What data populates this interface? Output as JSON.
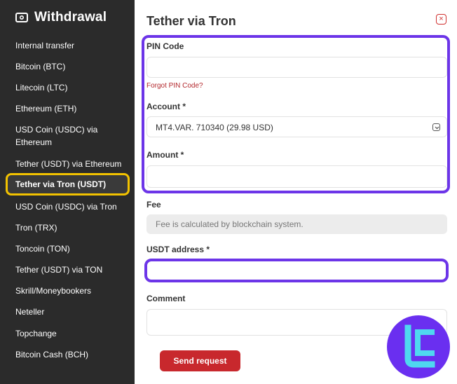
{
  "sidebar": {
    "title": "Withdrawal",
    "items": [
      {
        "label": "Internal transfer"
      },
      {
        "label": "Bitcoin (BTC)"
      },
      {
        "label": "Litecoin (LTC)"
      },
      {
        "label": "Ethereum (ETH)"
      },
      {
        "label": "USD Coin (USDC) via Ethereum"
      },
      {
        "label": "Tether (USDT) via Ethereum"
      },
      {
        "label": "Tether via Tron (USDT)"
      },
      {
        "label": "USD Coin (USDC) via Tron"
      },
      {
        "label": "Tron (TRX)"
      },
      {
        "label": "Toncoin (TON)"
      },
      {
        "label": "Tether (USDT) via TON"
      },
      {
        "label": "Skrill/Moneybookers"
      },
      {
        "label": "Neteller"
      },
      {
        "label": "Topchange"
      },
      {
        "label": "Bitcoin Cash (BCH)"
      }
    ],
    "active_index": 6
  },
  "form": {
    "title": "Tether via Tron",
    "close_symbol": "×",
    "pin_label": "PIN Code",
    "pin_value": "",
    "forgot_pin": "Forgot PIN Code?",
    "account_label": "Account *",
    "account_value": "MT4.VAR. 710340 (29.98 USD)",
    "amount_label": "Amount *",
    "amount_value": "",
    "fee_label": "Fee",
    "fee_value": "Fee is calculated by blockchain system.",
    "address_label": "USDT address *",
    "address_value": "",
    "comment_label": "Comment",
    "comment_value": "",
    "send_label": "Send request"
  },
  "colors": {
    "sidebar_bg": "#2b2b2b",
    "active_outline": "#f2c200",
    "highlight": "#6c35e8",
    "accent_red": "#c8282d",
    "logo_bg": "#6a2ff0",
    "logo_mark": "#4fd8f0"
  },
  "icons": {
    "sidebar_header": "wallet-icon",
    "close": "close-icon",
    "select": "chevron-down-icon",
    "brand": "brand-logo"
  }
}
